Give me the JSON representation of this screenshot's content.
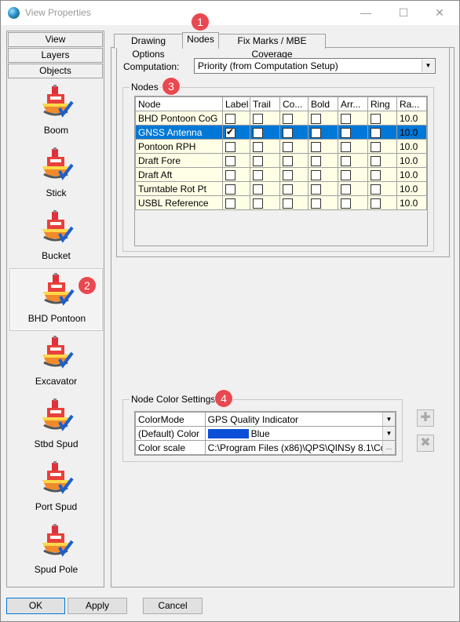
{
  "window": {
    "title": "View Properties",
    "icon": "globe-icon"
  },
  "titlebar_buttons": {
    "minimize": "—",
    "maximize": "☐",
    "close": "✕"
  },
  "sidebar": {
    "tabs": [
      {
        "label": "View"
      },
      {
        "label": "Layers"
      },
      {
        "label": "Objects"
      }
    ],
    "objects": [
      {
        "label": "Boom"
      },
      {
        "label": "Stick"
      },
      {
        "label": "Bucket"
      },
      {
        "label": "BHD Pontoon"
      },
      {
        "label": "Excavator"
      },
      {
        "label": "Stbd Spud"
      },
      {
        "label": "Port Spud"
      },
      {
        "label": "Spud Pole"
      }
    ],
    "selected": "BHD Pontoon"
  },
  "tabs": [
    {
      "label": "Drawing Options"
    },
    {
      "label": "Nodes"
    },
    {
      "label": "Fix Marks / MBE Coverage"
    }
  ],
  "active_tab": "Nodes",
  "computation": {
    "label": "Computation:",
    "value": "Priority (from Computation Setup)"
  },
  "nodes": {
    "group_title": "Nodes",
    "columns": [
      "Node",
      "Label",
      "Trail",
      "Co...",
      "Bold",
      "Arr...",
      "Ring",
      "Ra..."
    ],
    "rows": [
      {
        "name": "BHD Pontoon CoG",
        "label": false,
        "ra": "10.0"
      },
      {
        "name": "GNSS Antenna",
        "label": true,
        "ra": "10.0"
      },
      {
        "name": "Pontoon RPH",
        "label": false,
        "ra": "10.0"
      },
      {
        "name": "Draft Fore",
        "label": false,
        "ra": "10.0"
      },
      {
        "name": "Draft Aft",
        "label": false,
        "ra": "10.0"
      },
      {
        "name": "Turntable Rot Pt",
        "label": false,
        "ra": "10.0"
      },
      {
        "name": "USBL Reference",
        "label": false,
        "ra": "10.0"
      }
    ],
    "selected_row": "GNSS Antenna"
  },
  "node_color": {
    "group_title": "Node Color Settings",
    "rows": [
      {
        "key": "ColorMode",
        "value": "GPS Quality Indicator"
      },
      {
        "key": "(Default) Color",
        "value": "Blue"
      },
      {
        "key": "Color scale",
        "value": "C:\\Program Files (x86)\\QPS\\QINSy 8.1\\Co"
      }
    ],
    "swatch_color": "#0a4fd6",
    "add_icon": "plus-icon",
    "remove_icon": "delete-icon"
  },
  "buttons": {
    "ok": "OK",
    "apply": "Apply",
    "cancel": "Cancel"
  },
  "badges": [
    "1",
    "2",
    "3",
    "4"
  ],
  "colors": {
    "selection": "#0078d7",
    "badge": "#e8484f",
    "grid_cell": "#ffffe6"
  }
}
